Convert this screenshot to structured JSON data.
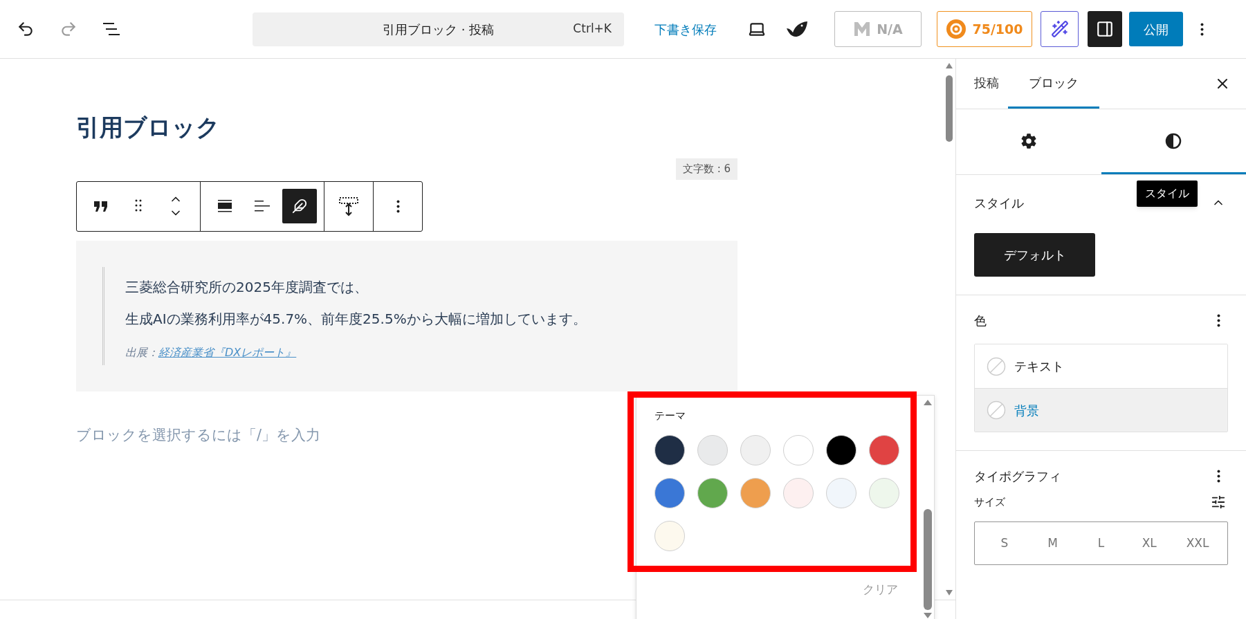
{
  "header": {
    "command_bar": {
      "title": "引用ブロック · 投稿",
      "shortcut": "Ctrl+K"
    },
    "save_draft": "下書き保存",
    "seo_status": "N/A",
    "score": "75/100",
    "publish": "公開"
  },
  "editor": {
    "title": "引用ブロック",
    "word_count": "文字数 : 6",
    "block_toolbar": [
      {
        "kind": "quote",
        "selected": false
      },
      {
        "kind": "drag",
        "selected": false
      },
      {
        "kind": "move",
        "selected": false
      },
      {
        "kind": "wide",
        "selected": false
      },
      {
        "kind": "align",
        "selected": false
      },
      {
        "kind": "style",
        "selected": true
      },
      {
        "kind": "spacing",
        "selected": false
      },
      {
        "kind": "more",
        "selected": false
      }
    ],
    "quote": {
      "lines": [
        "三菱総合研究所の2025年度調査では、",
        "生成AIの業務利用率が45.7%、前年度25.5%から大幅に増加しています。"
      ],
      "citation_prefix": "出展：",
      "citation_link": "経済産業省『DXレポート』"
    },
    "placeholder": "ブロックを選択するには「/」を入力"
  },
  "color_popover": {
    "heading": "テーマ",
    "swatches": [
      {
        "color": "#1f2e45"
      },
      {
        "color": "#e9eaeb"
      },
      {
        "color": "#f0f0f0"
      },
      {
        "color": "#ffffff"
      },
      {
        "color": "#000000"
      },
      {
        "color": "#e04343"
      },
      {
        "color": "#3a77d6"
      },
      {
        "color": "#61a84d"
      },
      {
        "color": "#ee9e4e"
      },
      {
        "color": "#fdf0f0"
      },
      {
        "color": "#f1f6fb"
      },
      {
        "color": "#eef7ec"
      },
      {
        "color": "#fdf9ee"
      }
    ],
    "clear": "クリア"
  },
  "sidebar": {
    "tabs": [
      {
        "label": "投稿",
        "selected": false
      },
      {
        "label": "ブロック",
        "selected": true
      }
    ],
    "subtabs": [
      {
        "kind": "settings",
        "selected": false
      },
      {
        "kind": "styles",
        "selected": true
      }
    ],
    "tooltip": "スタイル",
    "style_panel": {
      "title": "スタイル",
      "expanded": true,
      "button": "デフォルト"
    },
    "color_panel": {
      "title": "色",
      "items": [
        {
          "label": "テキスト",
          "selected": false
        },
        {
          "label": "背景",
          "selected": true
        }
      ]
    },
    "typography_panel": {
      "title": "タイポグラフィ",
      "size_label": "サイズ",
      "sizes": [
        "S",
        "M",
        "L",
        "XL",
        "XXL"
      ]
    }
  }
}
